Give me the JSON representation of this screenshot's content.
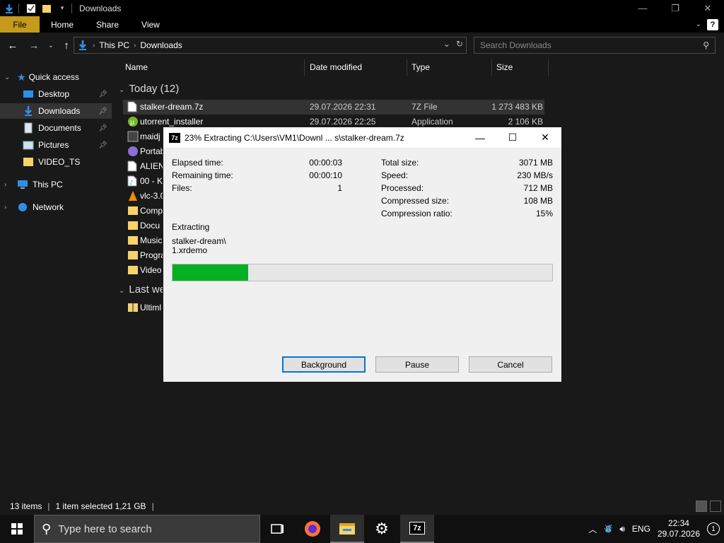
{
  "window": {
    "title": "Downloads"
  },
  "ribbon": {
    "tabs": [
      "File",
      "Home",
      "Share",
      "View"
    ]
  },
  "address": {
    "crumbs": [
      "This PC",
      "Downloads"
    ],
    "search_placeholder": "Search Downloads"
  },
  "nav": {
    "quick_access": "Quick access",
    "items": [
      {
        "label": "Desktop",
        "pinned": true
      },
      {
        "label": "Downloads",
        "pinned": true
      },
      {
        "label": "Documents",
        "pinned": true
      },
      {
        "label": "Pictures",
        "pinned": true
      },
      {
        "label": "VIDEO_TS",
        "pinned": false
      }
    ],
    "this_pc": "This PC",
    "network": "Network"
  },
  "columns": {
    "name": "Name",
    "date": "Date modified",
    "type": "Type",
    "size": "Size"
  },
  "groups": {
    "today": "Today (12)",
    "last_week": "Last we"
  },
  "files": [
    {
      "name": "stalker-dream.7z",
      "date": "29.07.2026 22:31",
      "type": "7Z File",
      "size": "1 273 483 KB"
    },
    {
      "name": "utorrent_installer",
      "date": "29.07.2026 22:25",
      "type": "Application",
      "size": "2 106 KB"
    },
    {
      "name": "maidj",
      "date": "",
      "type": "",
      "size": ""
    },
    {
      "name": "Portab",
      "date": "",
      "type": "",
      "size": ""
    },
    {
      "name": "ALIEN",
      "date": "",
      "type": "",
      "size": ""
    },
    {
      "name": "00 - K",
      "date": "",
      "type": "",
      "size": ""
    },
    {
      "name": "vlc-3.0",
      "date": "",
      "type": "",
      "size": ""
    },
    {
      "name": "Comp",
      "date": "",
      "type": "",
      "size": ""
    },
    {
      "name": "Docu",
      "date": "",
      "type": "",
      "size": ""
    },
    {
      "name": "Music",
      "date": "",
      "type": "",
      "size": ""
    },
    {
      "name": "Progra",
      "date": "",
      "type": "",
      "size": ""
    },
    {
      "name": "Video",
      "date": "",
      "type": "",
      "size": ""
    }
  ],
  "last_week_files": [
    {
      "name": "Ultiml"
    }
  ],
  "status": {
    "items": "13 items",
    "selected": "1 item selected  1,21 GB"
  },
  "taskbar": {
    "search_placeholder": "Type here to search",
    "lang": "ENG",
    "time": "22:34",
    "date": "29.07.2026",
    "notif_count": "1"
  },
  "dialog": {
    "title": "23% Extracting C:\\Users\\VM1\\Downl ... s\\stalker-dream.7z",
    "app_icon": "7z",
    "elapsed_label": "Elapsed time:",
    "elapsed_value": "00:00:03",
    "remaining_label": "Remaining time:",
    "remaining_value": "00:00:10",
    "files_label": "Files:",
    "files_value": "1",
    "total_label": "Total size:",
    "total_value": "3071 MB",
    "speed_label": "Speed:",
    "speed_value": "230 MB/s",
    "processed_label": "Processed:",
    "processed_value": "712 MB",
    "compressed_label": "Compressed size:",
    "compressed_value": "108 MB",
    "ratio_label": "Compression ratio:",
    "ratio_value": "15%",
    "status_label": "Extracting",
    "current_file_line1": "stalker-dream\\",
    "current_file_line2": "1.xrdemo",
    "progress_percent": 20,
    "background_label": "Background",
    "pause_label": "Pause",
    "cancel_label": "Cancel"
  },
  "colors": {
    "file_tab": "#c59a1d",
    "progress_fill": "#06b025",
    "accent": "#0078d7"
  }
}
